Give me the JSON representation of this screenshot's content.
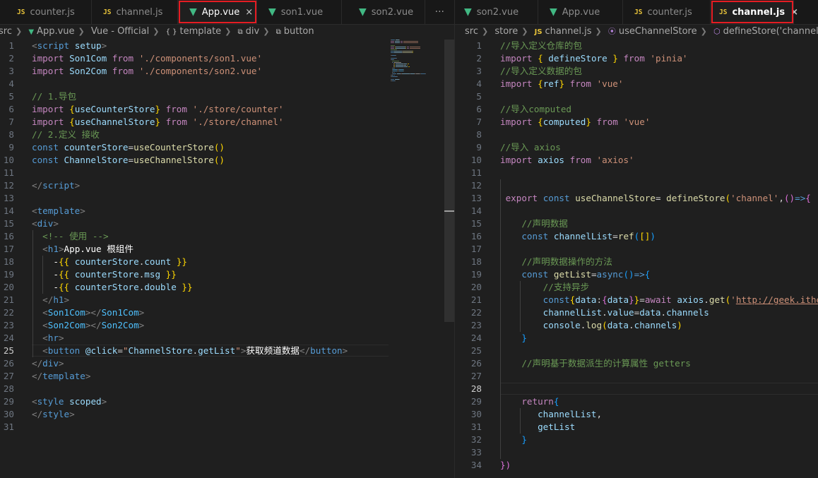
{
  "left_tabs": [
    {
      "icon": "js",
      "label": "counter.js"
    },
    {
      "icon": "js",
      "label": "channel.js"
    },
    {
      "icon": "vue",
      "label": "App.vue",
      "close": "×"
    },
    {
      "icon": "vue",
      "label": "son1.vue"
    },
    {
      "icon": "vue",
      "label": "son2.vue"
    }
  ],
  "left_more": "···",
  "right_tabs": [
    {
      "icon": "vue",
      "label": "son2.vue"
    },
    {
      "icon": "vue",
      "label": "App.vue"
    },
    {
      "icon": "js",
      "label": "counter.js"
    },
    {
      "icon": "js",
      "label": "channel.js",
      "close": "×"
    }
  ],
  "icon_text": {
    "js": "JS",
    "vue": "▼"
  },
  "left_breadcrumb": [
    "src",
    "App.vue",
    "Vue - Official",
    "template",
    "div",
    "button"
  ],
  "left_breadcrumb_icons": [
    "",
    "vue-icon",
    "",
    "braces-icon",
    "element-icon",
    "element-icon"
  ],
  "right_breadcrumb": [
    "src",
    "store",
    "channel.js",
    "useChannelStore",
    "defineStore('channel') callb"
  ],
  "left_code": [
    [
      [
        "tag",
        "<"
      ],
      [
        "tn",
        "script"
      ],
      [
        "plain",
        " "
      ],
      [
        "var",
        "setup"
      ],
      [
        "tag",
        ">"
      ]
    ],
    [
      [
        "kw",
        "import"
      ],
      [
        "plain",
        " "
      ],
      [
        "var",
        "Son1Com"
      ],
      [
        "plain",
        " "
      ],
      [
        "kw",
        "from"
      ],
      [
        "plain",
        " "
      ],
      [
        "str",
        "'./components/son1.vue'"
      ]
    ],
    [
      [
        "kw",
        "import"
      ],
      [
        "plain",
        " "
      ],
      [
        "var",
        "Son2Com"
      ],
      [
        "plain",
        " "
      ],
      [
        "kw",
        "from"
      ],
      [
        "plain",
        " "
      ],
      [
        "str",
        "'./components/son2.vue'"
      ]
    ],
    [],
    [
      [
        "cm",
        "// 1.导包"
      ]
    ],
    [
      [
        "kw",
        "import"
      ],
      [
        "plain",
        " "
      ],
      [
        "br",
        "{"
      ],
      [
        "var",
        "useCounterStore"
      ],
      [
        "br",
        "}"
      ],
      [
        "plain",
        " "
      ],
      [
        "kw",
        "from"
      ],
      [
        "plain",
        " "
      ],
      [
        "str",
        "'./store/counter'"
      ]
    ],
    [
      [
        "kw",
        "import"
      ],
      [
        "plain",
        " "
      ],
      [
        "br",
        "{"
      ],
      [
        "var",
        "useChannelStore"
      ],
      [
        "br",
        "}"
      ],
      [
        "plain",
        " "
      ],
      [
        "kw",
        "from"
      ],
      [
        "plain",
        " "
      ],
      [
        "str",
        "'./store/channel'"
      ]
    ],
    [
      [
        "cm",
        "// 2.定义 接收"
      ]
    ],
    [
      [
        "dk",
        "const"
      ],
      [
        "plain",
        " "
      ],
      [
        "var",
        "counterStore"
      ],
      [
        "plain",
        "="
      ],
      [
        "fn",
        "useCounterStore"
      ],
      [
        "br",
        "()"
      ]
    ],
    [
      [
        "dk",
        "const"
      ],
      [
        "plain",
        " "
      ],
      [
        "var",
        "ChannelStore"
      ],
      [
        "plain",
        "="
      ],
      [
        "fn",
        "useChannelStore"
      ],
      [
        "br",
        "()"
      ]
    ],
    [],
    [
      [
        "tag",
        "</"
      ],
      [
        "tn",
        "script"
      ],
      [
        "tag",
        ">"
      ]
    ],
    [],
    [
      [
        "tag",
        "<"
      ],
      [
        "tn",
        "template"
      ],
      [
        "tag",
        ">"
      ]
    ],
    [
      [
        "tag",
        "<"
      ],
      [
        "tn",
        "div"
      ],
      [
        "tag",
        ">"
      ]
    ],
    [
      [
        "plain",
        "  "
      ],
      [
        "cm",
        "<!-- 使用 -->"
      ]
    ],
    [
      [
        "plain",
        "  "
      ],
      [
        "tag",
        "<"
      ],
      [
        "tn",
        "h1"
      ],
      [
        "tag",
        ">"
      ],
      [
        "txt",
        "App.vue 根组件"
      ]
    ],
    [
      [
        "plain",
        "    "
      ],
      [
        "txt",
        "-"
      ],
      [
        "br",
        "{{"
      ],
      [
        "plain",
        " "
      ],
      [
        "var",
        "counterStore"
      ],
      [
        "plain",
        "."
      ],
      [
        "var",
        "count"
      ],
      [
        "plain",
        " "
      ],
      [
        "br",
        "}}"
      ]
    ],
    [
      [
        "plain",
        "    "
      ],
      [
        "txt",
        "-"
      ],
      [
        "br",
        "{{"
      ],
      [
        "plain",
        " "
      ],
      [
        "var",
        "counterStore"
      ],
      [
        "plain",
        "."
      ],
      [
        "var",
        "msg"
      ],
      [
        "plain",
        " "
      ],
      [
        "br",
        "}}"
      ]
    ],
    [
      [
        "plain",
        "    "
      ],
      [
        "txt",
        "-"
      ],
      [
        "br",
        "{{"
      ],
      [
        "plain",
        " "
      ],
      [
        "var",
        "counterStore"
      ],
      [
        "plain",
        "."
      ],
      [
        "var",
        "double"
      ],
      [
        "plain",
        " "
      ],
      [
        "br",
        "}}"
      ]
    ],
    [
      [
        "plain",
        "  "
      ],
      [
        "tag",
        "</"
      ],
      [
        "tn",
        "h1"
      ],
      [
        "tag",
        ">"
      ]
    ],
    [
      [
        "plain",
        "  "
      ],
      [
        "tag",
        "<"
      ],
      [
        "cst",
        "Son1Com"
      ],
      [
        "tag",
        "></"
      ],
      [
        "cst",
        "Son1Com"
      ],
      [
        "tag",
        ">"
      ]
    ],
    [
      [
        "plain",
        "  "
      ],
      [
        "tag",
        "<"
      ],
      [
        "cst",
        "Son2Com"
      ],
      [
        "tag",
        "></"
      ],
      [
        "cst",
        "Son2Com"
      ],
      [
        "tag",
        ">"
      ]
    ],
    [
      [
        "plain",
        "  "
      ],
      [
        "tag",
        "<"
      ],
      [
        "tn",
        "hr"
      ],
      [
        "tag",
        ">"
      ]
    ],
    [
      [
        "plain",
        "  "
      ],
      [
        "tag",
        "<"
      ],
      [
        "tn",
        "button"
      ],
      [
        "plain",
        " "
      ],
      [
        "var",
        "@click"
      ],
      [
        "plain",
        "="
      ],
      [
        "str",
        "\""
      ],
      [
        "var",
        "ChannelStore"
      ],
      [
        "plain",
        "."
      ],
      [
        "var",
        "getList"
      ],
      [
        "str",
        "\""
      ],
      [
        "tag",
        ">"
      ],
      [
        "txt",
        "获取频道数据"
      ],
      [
        "tag",
        "</"
      ],
      [
        "tn",
        "button"
      ],
      [
        "tag",
        ">"
      ]
    ],
    [
      [
        "tag",
        "</"
      ],
      [
        "tn",
        "div"
      ],
      [
        "tag",
        ">"
      ]
    ],
    [
      [
        "tag",
        "</"
      ],
      [
        "tn",
        "template"
      ],
      [
        "tag",
        ">"
      ]
    ],
    [],
    [
      [
        "tag",
        "<"
      ],
      [
        "tn",
        "style"
      ],
      [
        "plain",
        " "
      ],
      [
        "var",
        "scoped"
      ],
      [
        "tag",
        ">"
      ]
    ],
    [
      [
        "tag",
        "</"
      ],
      [
        "tn",
        "style"
      ],
      [
        "tag",
        ">"
      ]
    ],
    []
  ],
  "right_code": [
    [
      [
        "cm",
        "//导入定义仓库的包"
      ]
    ],
    [
      [
        "kw",
        "import"
      ],
      [
        "plain",
        " "
      ],
      [
        "br",
        "{"
      ],
      [
        "plain",
        " "
      ],
      [
        "var",
        "defineStore"
      ],
      [
        "plain",
        " "
      ],
      [
        "br",
        "}"
      ],
      [
        "plain",
        " "
      ],
      [
        "kw",
        "from"
      ],
      [
        "plain",
        " "
      ],
      [
        "str",
        "'pinia'"
      ]
    ],
    [
      [
        "cm",
        "//导入定义数据的包"
      ]
    ],
    [
      [
        "kw",
        "import"
      ],
      [
        "plain",
        " "
      ],
      [
        "br",
        "{"
      ],
      [
        "var",
        "ref"
      ],
      [
        "br",
        "}"
      ],
      [
        "plain",
        " "
      ],
      [
        "kw",
        "from"
      ],
      [
        "plain",
        " "
      ],
      [
        "str",
        "'vue'"
      ]
    ],
    [],
    [
      [
        "cm",
        "//导入computed"
      ]
    ],
    [
      [
        "kw",
        "import"
      ],
      [
        "plain",
        " "
      ],
      [
        "br",
        "{"
      ],
      [
        "var",
        "computed"
      ],
      [
        "br",
        "}"
      ],
      [
        "plain",
        " "
      ],
      [
        "kw",
        "from"
      ],
      [
        "plain",
        " "
      ],
      [
        "str",
        "'vue'"
      ]
    ],
    [],
    [
      [
        "cm",
        "//导入 axios"
      ]
    ],
    [
      [
        "kw",
        "import"
      ],
      [
        "plain",
        " "
      ],
      [
        "var",
        "axios"
      ],
      [
        "plain",
        " "
      ],
      [
        "kw",
        "from"
      ],
      [
        "plain",
        " "
      ],
      [
        "str",
        "'axios'"
      ]
    ],
    [],
    [],
    [
      [
        "plain",
        " "
      ],
      [
        "kw",
        "export"
      ],
      [
        "plain",
        " "
      ],
      [
        "dk",
        "const"
      ],
      [
        "plain",
        " "
      ],
      [
        "fn",
        "useChannelStore"
      ],
      [
        "plain",
        "= "
      ],
      [
        "fn",
        "defineStore"
      ],
      [
        "br",
        "("
      ],
      [
        "str",
        "'channel'"
      ],
      [
        "plain",
        ","
      ],
      [
        "br2",
        "()"
      ],
      [
        "dk",
        "=>"
      ],
      [
        "br2",
        "{"
      ]
    ],
    [],
    [
      [
        "plain",
        "    "
      ],
      [
        "cm",
        "//声明数据"
      ]
    ],
    [
      [
        "plain",
        "    "
      ],
      [
        "dk",
        "const"
      ],
      [
        "plain",
        " "
      ],
      [
        "var",
        "channelList"
      ],
      [
        "plain",
        "="
      ],
      [
        "fn",
        "ref"
      ],
      [
        "br3",
        "("
      ],
      [
        "br",
        "[]"
      ],
      [
        "br3",
        ")"
      ]
    ],
    [],
    [
      [
        "plain",
        "    "
      ],
      [
        "cm",
        "//声明数据操作的方法"
      ]
    ],
    [
      [
        "plain",
        "    "
      ],
      [
        "dk",
        "const"
      ],
      [
        "plain",
        " "
      ],
      [
        "fn",
        "getList"
      ],
      [
        "plain",
        "="
      ],
      [
        "dk",
        "async"
      ],
      [
        "br3",
        "()"
      ],
      [
        "dk",
        "=>"
      ],
      [
        "br3",
        "{"
      ]
    ],
    [
      [
        "plain",
        "        "
      ],
      [
        "cm",
        "//支持异步"
      ]
    ],
    [
      [
        "plain",
        "        "
      ],
      [
        "dk",
        "const"
      ],
      [
        "br",
        "{"
      ],
      [
        "var",
        "data"
      ],
      [
        "plain",
        ":"
      ],
      [
        "br2",
        "{"
      ],
      [
        "var",
        "data"
      ],
      [
        "br2",
        "}"
      ],
      [
        "br",
        "}"
      ],
      [
        "plain",
        "="
      ],
      [
        "kw",
        "await"
      ],
      [
        "plain",
        " "
      ],
      [
        "var",
        "axios"
      ],
      [
        "plain",
        "."
      ],
      [
        "fn",
        "get"
      ],
      [
        "br",
        "("
      ],
      [
        "str",
        "'"
      ],
      [
        "url",
        "http://geek.itheima"
      ]
    ],
    [
      [
        "plain",
        "        "
      ],
      [
        "var",
        "channelList"
      ],
      [
        "plain",
        "."
      ],
      [
        "var",
        "value"
      ],
      [
        "plain",
        "="
      ],
      [
        "var",
        "data"
      ],
      [
        "plain",
        "."
      ],
      [
        "var",
        "channels"
      ]
    ],
    [
      [
        "plain",
        "        "
      ],
      [
        "var",
        "console"
      ],
      [
        "plain",
        "."
      ],
      [
        "fn",
        "log"
      ],
      [
        "br",
        "("
      ],
      [
        "var",
        "data"
      ],
      [
        "plain",
        "."
      ],
      [
        "var",
        "channels"
      ],
      [
        "br",
        ")"
      ]
    ],
    [
      [
        "plain",
        "    "
      ],
      [
        "br3",
        "}"
      ]
    ],
    [],
    [
      [
        "plain",
        "    "
      ],
      [
        "cm",
        "//声明基于数据派生的计算属性 getters"
      ]
    ],
    [],
    [],
    [
      [
        "plain",
        "    "
      ],
      [
        "kw",
        "return"
      ],
      [
        "br3",
        "{"
      ]
    ],
    [
      [
        "plain",
        "       "
      ],
      [
        "var",
        "channelList"
      ],
      [
        "plain",
        ","
      ]
    ],
    [
      [
        "plain",
        "       "
      ],
      [
        "var",
        "getList"
      ]
    ],
    [
      [
        "plain",
        "    "
      ],
      [
        "br3",
        "}"
      ]
    ],
    [],
    [
      [
        "br2",
        "})"
      ]
    ]
  ],
  "left_current_line": 25,
  "right_current_line": 28
}
